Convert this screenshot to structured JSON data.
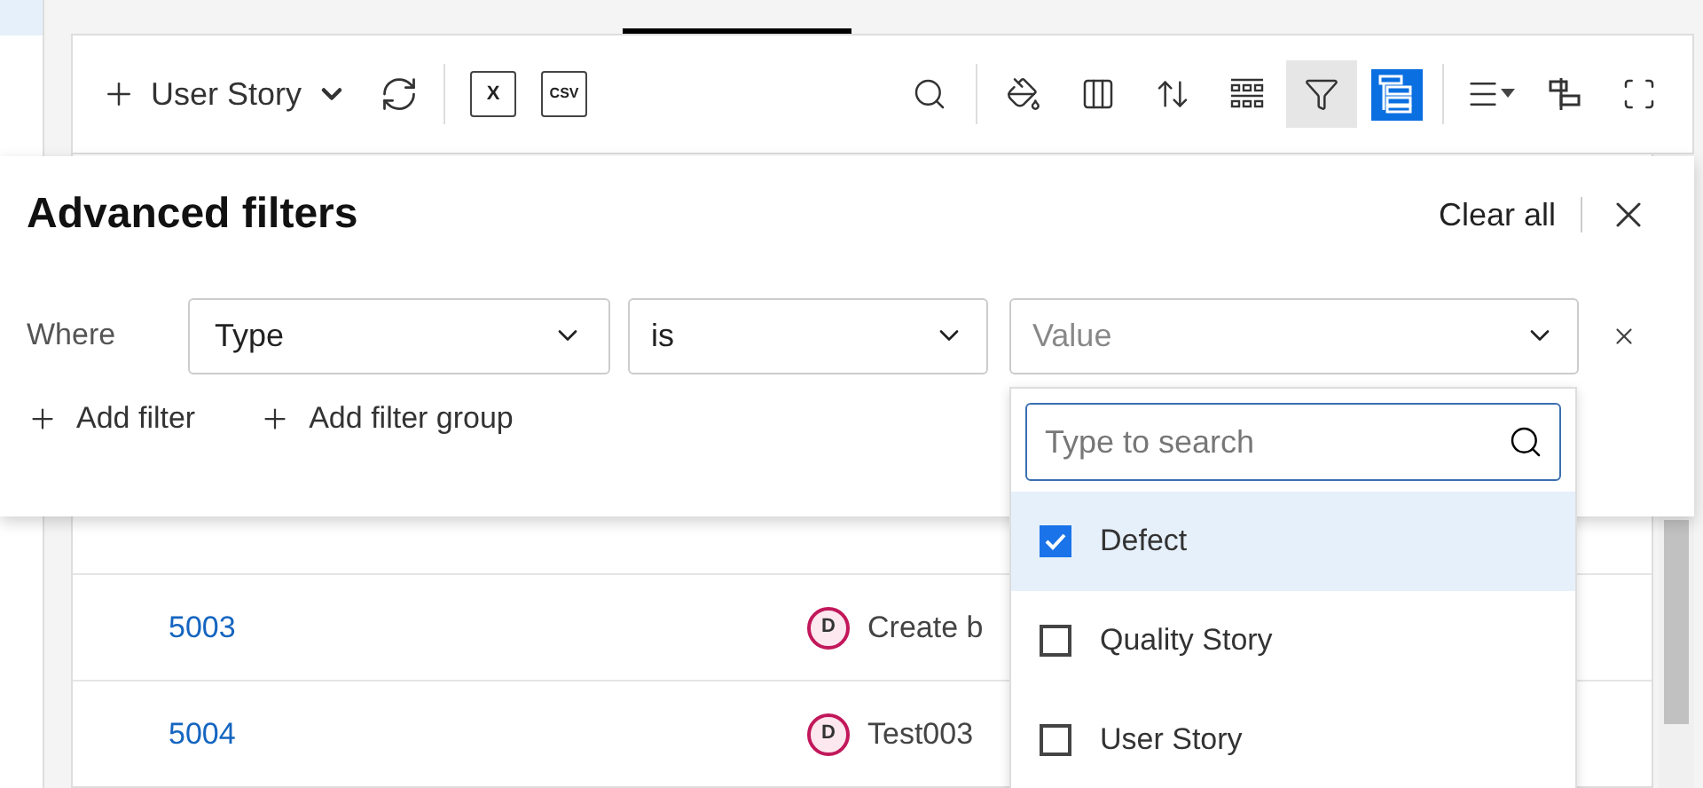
{
  "toolbar": {
    "new_button": {
      "label": "User Story"
    },
    "export_buttons": [
      {
        "kind": "excel",
        "mark": "X"
      },
      {
        "kind": "csv",
        "mark": "CSV"
      }
    ],
    "tools": [
      {
        "kind": "search",
        "on": false
      },
      {
        "kind": "paint",
        "on": false
      },
      {
        "kind": "columns",
        "on": false
      },
      {
        "kind": "sort",
        "on": false
      },
      {
        "kind": "group",
        "on": false
      },
      {
        "kind": "filter",
        "on": true
      },
      {
        "kind": "tree",
        "on": true
      },
      {
        "kind": "density",
        "on": false
      },
      {
        "kind": "align",
        "on": false
      },
      {
        "kind": "fullscreen",
        "on": false
      }
    ]
  },
  "advanced_filters": {
    "title": "Advanced filters",
    "clear_all": "Clear all",
    "filter": {
      "where": "Where",
      "field": "Type",
      "operator": "is",
      "value_placeholder": "Value"
    },
    "add_filter": "Add filter",
    "add_filter_group": "Add filter group"
  },
  "value_dropdown": {
    "search_placeholder": "Type to search",
    "options": [
      {
        "label": "Defect",
        "checked": true
      },
      {
        "label": "Quality Story",
        "checked": false
      },
      {
        "label": "User Story",
        "checked": false
      }
    ]
  },
  "table": {
    "rows": [
      {
        "id": "5003",
        "type_badge": "D",
        "title": "Create b"
      },
      {
        "id": "5004",
        "type_badge": "D",
        "title": "Test003"
      }
    ]
  }
}
